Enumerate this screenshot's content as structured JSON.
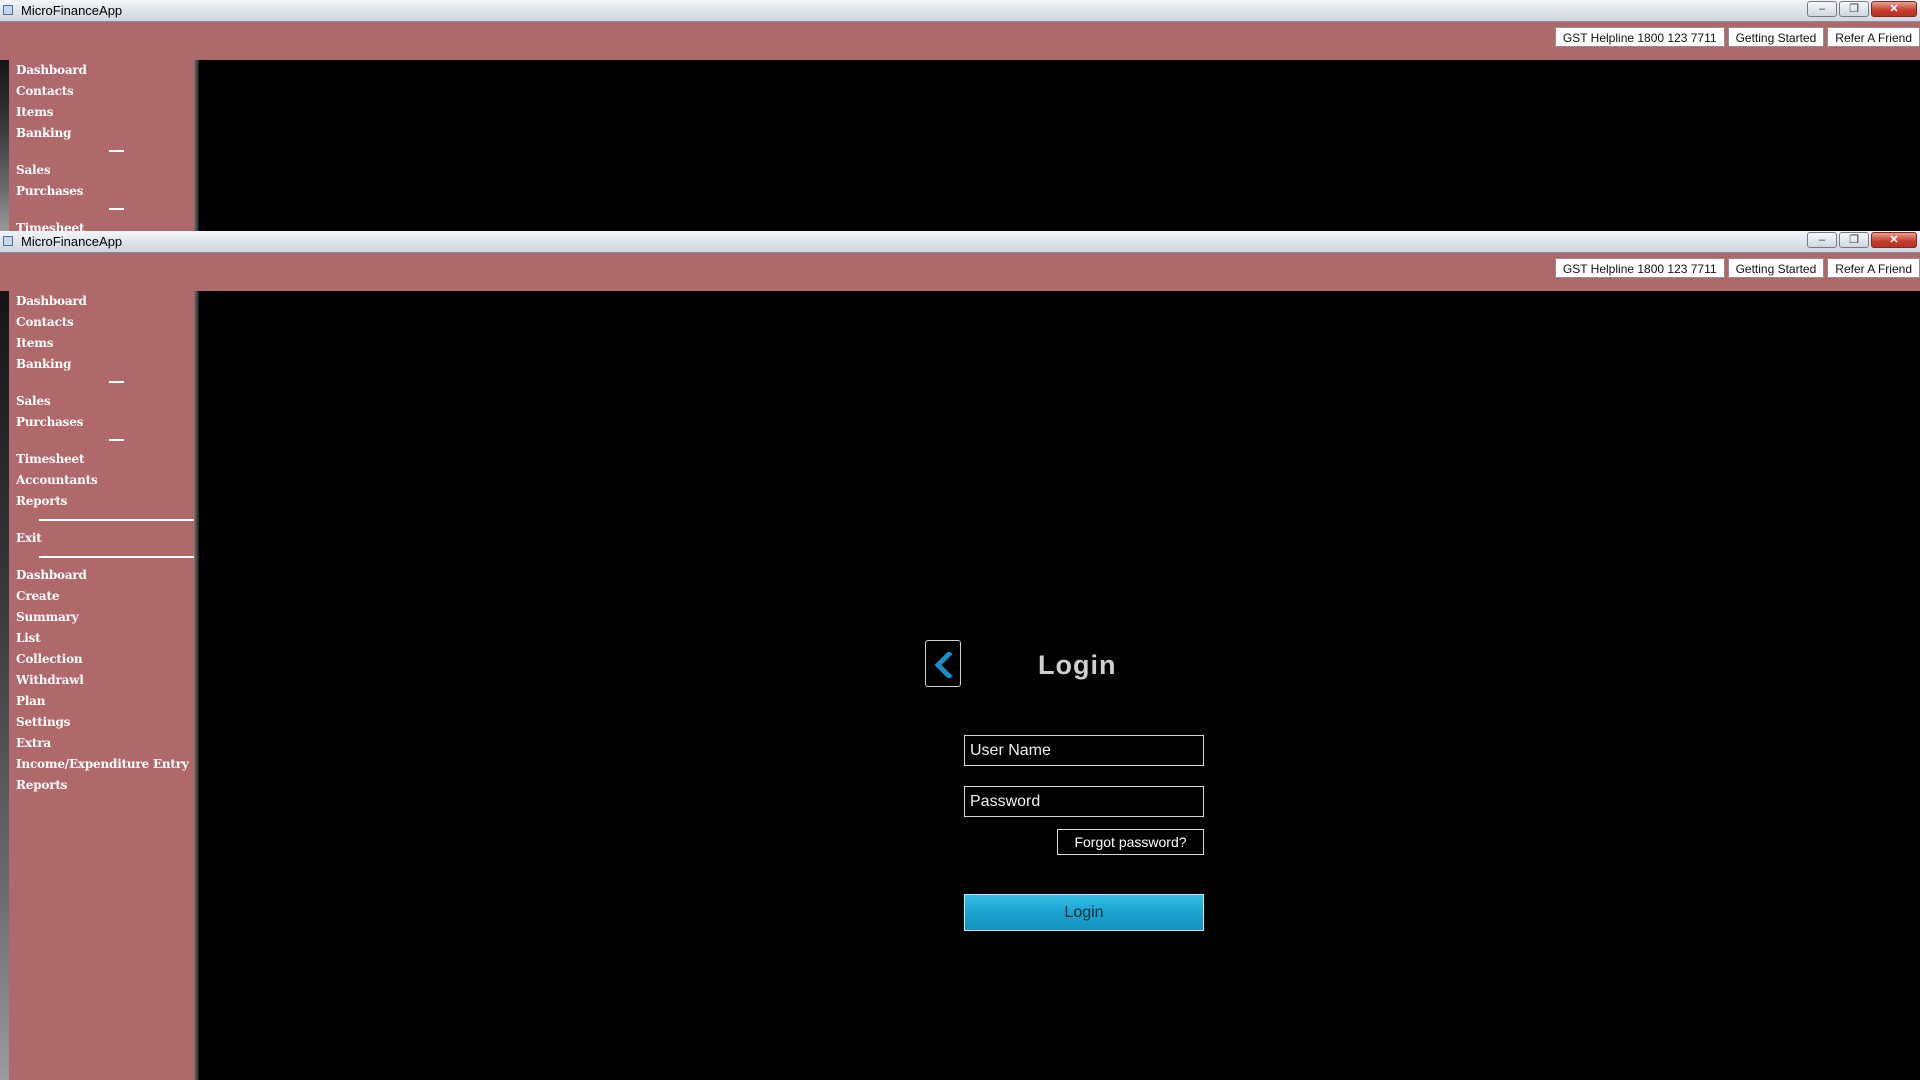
{
  "window_back": {
    "title": "MicroFinanceApp",
    "controls": {
      "minimize": "–",
      "restore": "❐",
      "close": "✕"
    },
    "top_links": [
      "GST Helpline  1800 123 7711",
      "Getting Started",
      "Refer A Friend"
    ],
    "nav_group1": [
      "Dashboard",
      "Contacts",
      "Items",
      "Banking"
    ],
    "nav_group2": [
      "Sales",
      "Purchases"
    ],
    "nav_group3": [
      "Timesheet"
    ]
  },
  "window_front": {
    "title": "MicroFinanceApp",
    "controls": {
      "minimize": "–",
      "restore": "❐",
      "close": "✕"
    },
    "top_links": [
      "GST Helpline  1800 123 7711",
      "Getting Started",
      "Refer A Friend"
    ],
    "nav_group1": [
      "Dashboard",
      "Contacts",
      "Items",
      "Banking"
    ],
    "nav_group2": [
      "Sales",
      "Purchases"
    ],
    "nav_group3": [
      "Timesheet",
      "Accountants",
      "Reports"
    ],
    "nav_exit": "Exit",
    "nav_group4": [
      "Dashboard",
      "Create",
      "Summary",
      "List",
      "Collection",
      "Withdrawl",
      "Plan",
      "Settings",
      "Extra",
      "Income/Expenditure Entry",
      "Reports"
    ]
  },
  "login": {
    "title": "Login",
    "username_placeholder": "User Name",
    "password_placeholder": "Password",
    "forgot_label": "Forgot password?",
    "login_label": "Login",
    "back_icon": "chevron-left-icon"
  },
  "colors": {
    "brand": "#b0696a",
    "login_button": "#1aa4cf",
    "back_chevron": "#1a8fc4"
  }
}
